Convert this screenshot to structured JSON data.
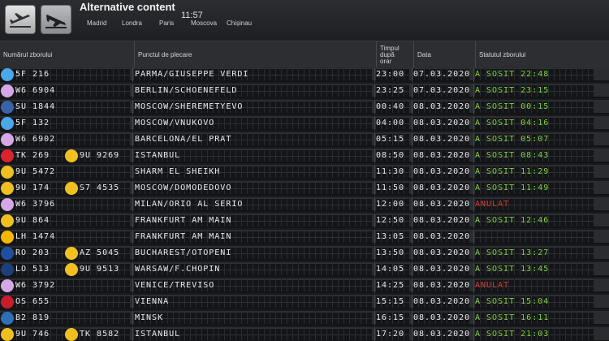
{
  "top": {
    "title": "Alternative content",
    "clock": "11:57",
    "cities": [
      "Madrid",
      "Londra",
      "Paris",
      "Moscova",
      "Chișinau"
    ]
  },
  "tabs": [
    {
      "name": "departures",
      "icon": "plane-takeoff-icon"
    },
    {
      "name": "arrivals",
      "icon": "plane-landing-icon"
    }
  ],
  "header": {
    "flight": "Numărul zborului",
    "origin": "Punctul de plecare",
    "time": [
      "Timpul",
      "după",
      "orar"
    ],
    "date": "Data",
    "status": "Statutul zborului"
  },
  "flights": [
    {
      "logo": "#4aa7e8",
      "code": "5F 216",
      "code2": "",
      "origin": "PARMA/GIUSEPPE VERDI",
      "time": "23:00",
      "date": "07.03.2020",
      "status": "A SOSIT 22:48",
      "state": "arrived"
    },
    {
      "logo": "#d6a7e6",
      "code": "W6 6904",
      "code2": "",
      "origin": "BERLIN/SCHOENEFELD",
      "time": "23:25",
      "date": "07.03.2020",
      "status": "A SOSIT 23:15",
      "state": "arrived"
    },
    {
      "logo": "#3a62a8",
      "code": "SU 1844",
      "code2": "",
      "origin": "MOSCOW/SHEREMETYEVO",
      "time": "00:40",
      "date": "08.03.2020",
      "status": "A SOSIT 00:15",
      "state": "arrived"
    },
    {
      "logo": "#4aa7e8",
      "code": "5F 132",
      "code2": "",
      "origin": "MOSCOW/VNUKOVO",
      "time": "04:00",
      "date": "08.03.2020",
      "status": "A SOSIT 04:16",
      "state": "arrived"
    },
    {
      "logo": "#d6a7e6",
      "code": "W6 6902",
      "code2": "",
      "origin": "BARCELONA/EL PRAT",
      "time": "05:15",
      "date": "08.03.2020",
      "status": "A SOSIT 05:07",
      "state": "arrived"
    },
    {
      "logo": "#d9232d",
      "code": "TK 269",
      "code2": "9U 9269",
      "origin": "ISTANBUL",
      "time": "08:50",
      "date": "08.03.2020",
      "status": "A SOSIT 08:43",
      "state": "arrived"
    },
    {
      "logo": "#f0c020",
      "code": "9U 5472",
      "code2": "",
      "origin": "SHARM EL SHEIKH",
      "time": "11:30",
      "date": "08.03.2020",
      "status": "A SOSIT 11:29",
      "state": "arrived"
    },
    {
      "logo": "#f0c020",
      "code": "9U 174",
      "code2": "S7 4535",
      "origin": "MOSCOW/DOMODEDOVO",
      "time": "11:50",
      "date": "08.03.2020",
      "status": "A SOSIT 11:49",
      "state": "arrived"
    },
    {
      "logo": "#d6a7e6",
      "code": "W6 3796",
      "code2": "",
      "origin": "MILAN/ORIO AL SERIO",
      "time": "12:00",
      "date": "08.03.2020",
      "status": "ANULAT",
      "state": "cancelled"
    },
    {
      "logo": "#f0c020",
      "code": "9U 864",
      "code2": "",
      "origin": "FRANKFURT AM MAIN",
      "time": "12:50",
      "date": "08.03.2020",
      "status": "A SOSIT 12:46",
      "state": "arrived"
    },
    {
      "logo": "#f5b800",
      "code": "LH 1474",
      "code2": "",
      "origin": "FRANKFURT AM MAIN",
      "time": "13:05",
      "date": "08.03.2020",
      "status": "",
      "state": "none"
    },
    {
      "logo": "#1f4fa0",
      "code": "RO 203",
      "code2": "AZ 5045",
      "origin": "BUCHAREST/OTOPENI",
      "time": "13:50",
      "date": "08.03.2020",
      "status": "A SOSIT 13:27",
      "state": "arrived"
    },
    {
      "logo": "#1d3f7a",
      "code": "LO 513",
      "code2": "9U 9513",
      "origin": "WARSAW/F.CHOPIN",
      "time": "14:05",
      "date": "08.03.2020",
      "status": "A SOSIT 13:45",
      "state": "arrived"
    },
    {
      "logo": "#d6a7e6",
      "code": "W6 3792",
      "code2": "",
      "origin": "VENICE/TREVISO",
      "time": "14:25",
      "date": "08.03.2020",
      "status": "ANULAT",
      "state": "cancelled"
    },
    {
      "logo": "#c81e2c",
      "code": "OS 655",
      "code2": "",
      "origin": "VIENNA",
      "time": "15:15",
      "date": "08.03.2020",
      "status": "A SOSIT 15:04",
      "state": "arrived"
    },
    {
      "logo": "#2e6fb8",
      "code": "B2 819",
      "code2": "",
      "origin": "MINSK",
      "time": "16:15",
      "date": "08.03.2020",
      "status": "A SOSIT 16:11",
      "state": "arrived"
    },
    {
      "logo": "#f0c020",
      "code": "9U 746",
      "code2": "TK 8582",
      "origin": "ISTANBUL",
      "time": "17:20",
      "date": "08.03.2020",
      "status": "A SOSIT 21:03",
      "state": "arrived"
    }
  ],
  "colors": {
    "arrived": "#7fd63c",
    "cancelled": "#e03a2c",
    "background": "#181a1d"
  }
}
